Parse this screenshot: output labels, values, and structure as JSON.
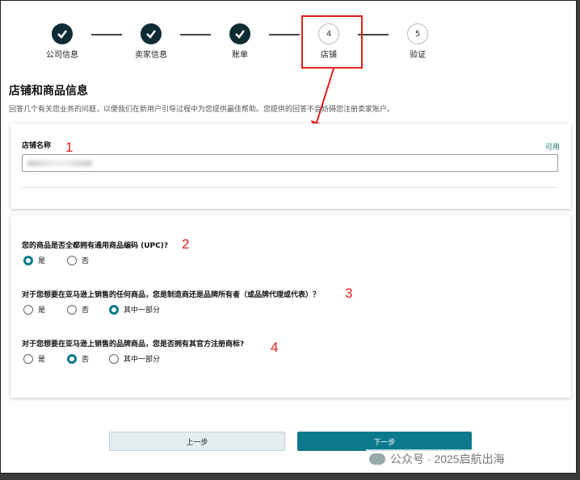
{
  "steps": [
    {
      "label": "公司信息",
      "state": "done"
    },
    {
      "label": "卖家信息",
      "state": "done"
    },
    {
      "label": "账单",
      "state": "done"
    },
    {
      "label": "店铺",
      "num": "4",
      "state": "current"
    },
    {
      "label": "验证",
      "num": "5",
      "state": "todo"
    }
  ],
  "page": {
    "title": "店铺和商品信息",
    "subtitle": "回答几个有关您业务的问题，以便我们在新用户引导过程中为您提供最佳帮助。您提供的回答不会妨碍您注册卖家账户。"
  },
  "store": {
    "name_label": "店铺名称",
    "available": "可用",
    "value": ""
  },
  "annotations": {
    "n1": "1",
    "n2": "2",
    "n3": "3",
    "n4": "4"
  },
  "questions": [
    {
      "text": "您的商品是否全都拥有通用商品编码 (UPC)?",
      "options": [
        "是",
        "否"
      ],
      "selected": 0
    },
    {
      "text": "对于您想要在亚马逊上销售的任何商品，您是制造商还是品牌所有者（或品牌代理或代表）？",
      "options": [
        "是",
        "否",
        "其中一部分"
      ],
      "selected": 2
    },
    {
      "text": "对于您想要在亚马逊上销售的品牌商品，您是否拥有其官方注册商标?",
      "options": [
        "是",
        "否",
        "其中一部分"
      ],
      "selected": 1
    }
  ],
  "buttons": {
    "prev": "上一步",
    "next": "下一步"
  },
  "watermark": "公众号 · 2025启航出海",
  "colors": {
    "accent": "#0c7a8c",
    "highlight": "#e31d1d",
    "done": "#0f2c35"
  }
}
